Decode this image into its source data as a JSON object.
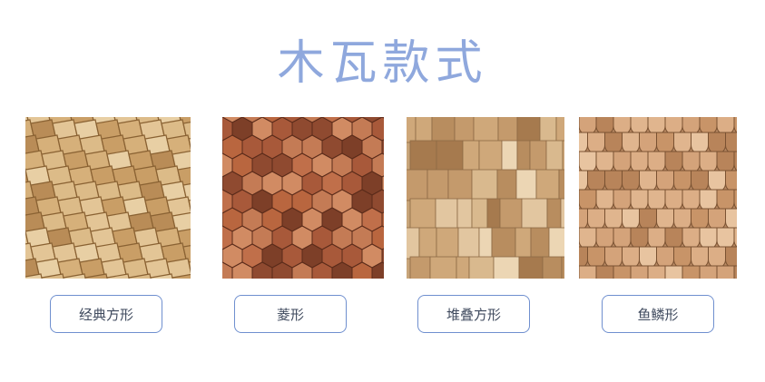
{
  "title": "木瓦款式",
  "styles": [
    {
      "label": "经典方形",
      "image": "classic-square-shingles-photo"
    },
    {
      "label": "菱形",
      "image": "diamond-shingles-photo"
    },
    {
      "label": "堆叠方形",
      "image": "stacked-square-shingles-photo"
    },
    {
      "label": "鱼鳞形",
      "image": "fish-scale-shingles-photo"
    }
  ],
  "colors": {
    "title": "#8fa8dd",
    "button_border": "#6f8fcf",
    "button_text": "#3f4a5e"
  }
}
